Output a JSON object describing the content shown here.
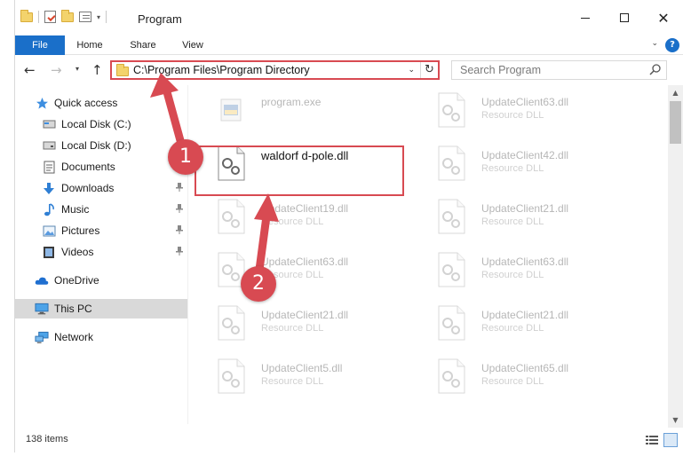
{
  "window": {
    "title": "Program",
    "colors": {
      "accent": "#1a6fc9",
      "highlight": "#d84a52",
      "selected": "#d9d9d9"
    }
  },
  "ribbon": {
    "tabs": [
      {
        "label": "File",
        "active": true
      },
      {
        "label": "Home"
      },
      {
        "label": "Share"
      },
      {
        "label": "View"
      }
    ],
    "help_icon": "?"
  },
  "address": {
    "path": "C:\\Program Files\\Program Directory",
    "refresh_icon": "↻"
  },
  "search": {
    "placeholder": "Search Program"
  },
  "navigation": {
    "items": [
      {
        "label": "Quick access",
        "icon": "star-icon",
        "level": "top"
      },
      {
        "label": "Local Disk (C:)",
        "icon": "drive-icon",
        "level": "sub"
      },
      {
        "label": "Local Disk (D:)",
        "icon": "drive-icon",
        "level": "sub"
      },
      {
        "label": "Documents",
        "icon": "document-icon",
        "level": "sub"
      },
      {
        "label": "Downloads",
        "icon": "download-icon",
        "level": "sub",
        "pinned": true
      },
      {
        "label": "Music",
        "icon": "music-icon",
        "level": "sub",
        "pinned": true
      },
      {
        "label": "Pictures",
        "icon": "picture-icon",
        "level": "sub",
        "pinned": true
      },
      {
        "label": "Videos",
        "icon": "video-icon",
        "level": "sub",
        "pinned": true
      },
      {
        "label": "OneDrive",
        "icon": "cloud-icon",
        "level": "top"
      },
      {
        "label": "This PC",
        "icon": "computer-icon",
        "level": "top",
        "selected": true
      },
      {
        "label": "Network",
        "icon": "network-icon",
        "level": "top"
      }
    ]
  },
  "files": [
    {
      "name": "program.exe",
      "type": "",
      "icon": "exe-icon",
      "faded": true
    },
    {
      "name": "UpdateClient63.dll",
      "type": "Resource DLL",
      "icon": "dll-icon",
      "faded": true
    },
    {
      "name": "waldorf d-pole.dll",
      "type": "",
      "icon": "dll-icon",
      "highlight": true
    },
    {
      "name": "UpdateClient42.dll",
      "type": "Resource DLL",
      "icon": "dll-icon",
      "faded": true
    },
    {
      "name": "UpdateClient19.dll",
      "type": "Resource DLL",
      "icon": "dll-icon",
      "faded": true
    },
    {
      "name": "UpdateClient21.dll",
      "type": "Resource DLL",
      "icon": "dll-icon",
      "faded": true
    },
    {
      "name": "UpdateClient63.dll",
      "type": "Resource DLL",
      "icon": "dll-icon",
      "faded": true
    },
    {
      "name": "UpdateClient63.dll",
      "type": "Resource DLL",
      "icon": "dll-icon",
      "faded": true
    },
    {
      "name": "UpdateClient21.dll",
      "type": "Resource DLL",
      "icon": "dll-icon",
      "faded": true
    },
    {
      "name": "UpdateClient21.dll",
      "type": "Resource DLL",
      "icon": "dll-icon",
      "faded": true
    },
    {
      "name": "UpdateClient5.dll",
      "type": "Resource DLL",
      "icon": "dll-icon",
      "faded": true
    },
    {
      "name": "UpdateClient65.dll",
      "type": "Resource DLL",
      "icon": "dll-icon",
      "faded": true
    }
  ],
  "status": {
    "item_count": "138 items"
  },
  "annotations": {
    "step1": "1",
    "step2": "2"
  }
}
